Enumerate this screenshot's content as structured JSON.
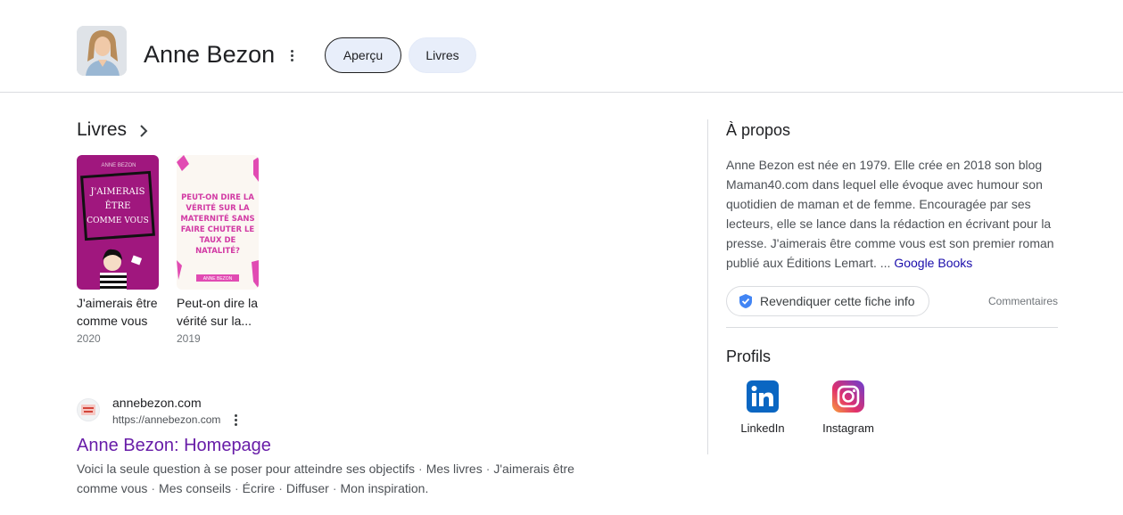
{
  "entity": {
    "name": "Anne Bezon",
    "tabs": [
      {
        "label": "Aperçu",
        "selected": true
      },
      {
        "label": "Livres",
        "selected": false
      }
    ]
  },
  "books": {
    "heading": "Livres",
    "items": [
      {
        "title": "J'aimerais être comme vous",
        "year": "2020",
        "cover_text": [
          "J'AIMERAIS",
          "ÊTRE",
          "COMME VOUS"
        ],
        "cover_author": "ANNE BEZON"
      },
      {
        "title": "Peut-on dire la vérité sur la...",
        "year": "2019",
        "cover_text": [
          "PEUT-ON DIRE LA",
          "VÉRITÉ SUR LA",
          "MATERNITÉ SANS",
          "FAIRE CHUTER LE",
          "TAUX DE",
          "NATALITÉ?"
        ],
        "cover_author": "ANNE BEZON"
      }
    ]
  },
  "result": {
    "site_name": "annebezon.com",
    "url": "https://annebezon.com",
    "title": "Anne Bezon: Homepage",
    "snippet_links": [
      "Voici la seule question à se poser pour atteindre ses objectifs",
      "Mes livres",
      "J'aimerais être comme vous",
      "Mes conseils",
      "Écrire",
      "Diffuser",
      "Mon inspiration."
    ]
  },
  "about": {
    "heading": "À propos",
    "text": "Anne Bezon est née en 1979. Elle crée en 2018 son blog Maman40.com dans lequel elle évoque avec humour son quotidien de maman et de femme. Encouragée par ses lecteurs, elle se lance dans la rédaction en écrivant pour la presse. J'aimerais être comme vous est son premier roman publié aux Éditions Lemart. ... ",
    "source_link": "Google Books",
    "claim_label": "Revendiquer cette fiche info",
    "feedback_label": "Commentaires"
  },
  "profiles": {
    "heading": "Profils",
    "items": [
      {
        "label": "LinkedIn",
        "icon": "linkedin-icon"
      },
      {
        "label": "Instagram",
        "icon": "instagram-icon"
      }
    ]
  },
  "colors": {
    "result_title": "#681da8",
    "link": "#1a0dab",
    "chip_bg": "#e8eefa",
    "linkedin": "#0a66c2",
    "verified": "#4285f4"
  }
}
